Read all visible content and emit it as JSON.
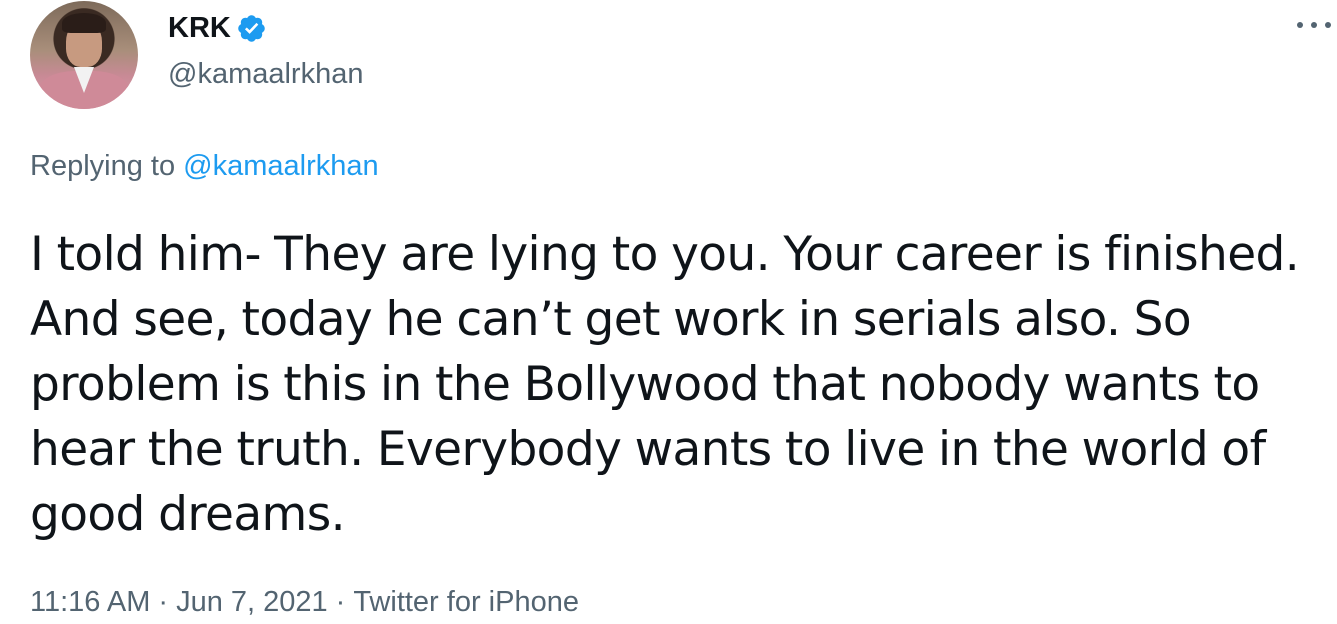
{
  "author": {
    "name": "KRK",
    "handle": "@kamaalrkhan",
    "verified": true
  },
  "reply": {
    "prefix": "Replying to",
    "to_handle": "@kamaalrkhan"
  },
  "tweet": {
    "lines": [
      "I told him- They are lying to you. Your career is finished.",
      "And see, today he can’t get work in serials also. So",
      "problem is this in the Bollywood that nobody wants to",
      "hear the truth. Everybody wants to live in the world of",
      "good dreams."
    ]
  },
  "meta": {
    "time": "11:16 AM",
    "date": "Jun 7, 2021",
    "source": "Twitter for iPhone",
    "separator": "·"
  },
  "icons": {
    "verified": "verified-badge-icon",
    "more": "more-options-icon"
  },
  "colors": {
    "verified_blue": "#1d9bf0",
    "link_blue": "#1d9bf0",
    "secondary_text": "#536471",
    "primary_text": "#0f1419"
  }
}
